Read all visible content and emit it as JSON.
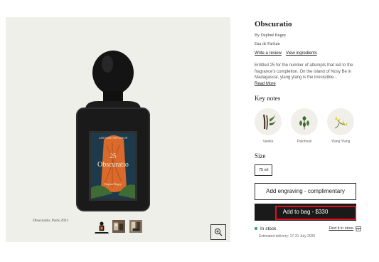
{
  "product": {
    "title": "Obscuratio",
    "byline": "By Daphné Bugey",
    "type": "Eau de Parfum",
    "write_review": "Write a review",
    "view_ingredients": "View ingredients",
    "description": "Entitled 25 for the number of attempts that led to the fragrance's completion. On the island of Nosy Be in Madagascar, ylang ylang is the irresistible...",
    "read_more": "Read More"
  },
  "gallery": {
    "caption": "Obscuratio, Paris 2021",
    "label_brand": "L'ARTISAN PARFUMEUR",
    "label_number": "25",
    "label_name": "Obscuratio",
    "label_author": "Daphné Bugey",
    "thumbnails": [
      "bottle-thumbnail",
      "scene-thumbnail-1",
      "scene-thumbnail-2"
    ],
    "zoom_icon": "zoom-in-icon"
  },
  "key_notes": {
    "heading": "Key notes",
    "items": [
      {
        "label": "Vanilla",
        "icon": "vanilla-icon"
      },
      {
        "label": "Patchouli",
        "icon": "patchouli-icon"
      },
      {
        "label": "Ylang Ylang",
        "icon": "ylang-ylang-icon"
      }
    ]
  },
  "size": {
    "heading": "Size",
    "selected": "75 ml"
  },
  "actions": {
    "engraving": "Add engraving - complimentary",
    "add_to_bag": "Add to bag - $330"
  },
  "availability": {
    "status": "In stock",
    "find_in_store": "Find it in store",
    "delivery": "Estimated delivery: 17-31 July 2026"
  },
  "colors": {
    "stock_dot": "#2e9e5b",
    "highlight": "#e0101a",
    "button_dark": "#1a1a1a"
  }
}
